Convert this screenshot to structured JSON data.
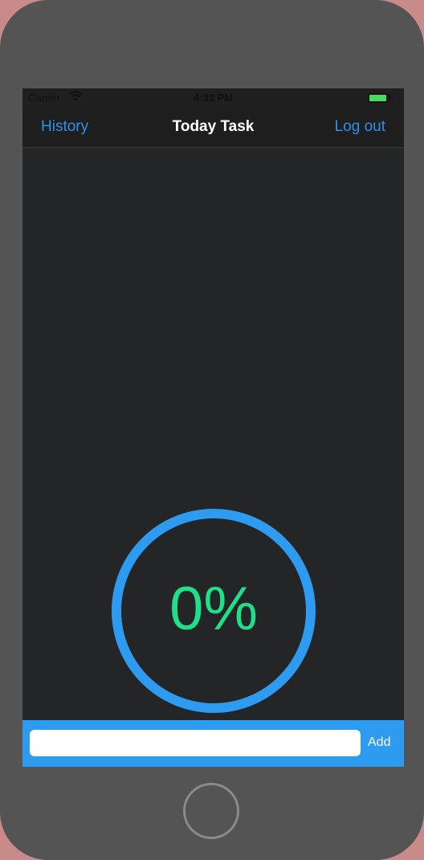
{
  "status_bar": {
    "carrier": "Carrier",
    "time": "4:33 PM",
    "wifi_icon": "wifi-icon",
    "battery_icon": "battery-icon",
    "battery_color": "#4cd964"
  },
  "nav": {
    "left_label": "History",
    "title": "Today Task",
    "right_label": "Log out",
    "accent": "#2e90e8"
  },
  "progress": {
    "label": "0%",
    "value": 0,
    "ring_color": "#2d9bf0",
    "text_color": "#1edf8a"
  },
  "task_input": {
    "value": "",
    "placeholder": "",
    "add_label": "Add",
    "bar_color": "#2d9bf0"
  }
}
